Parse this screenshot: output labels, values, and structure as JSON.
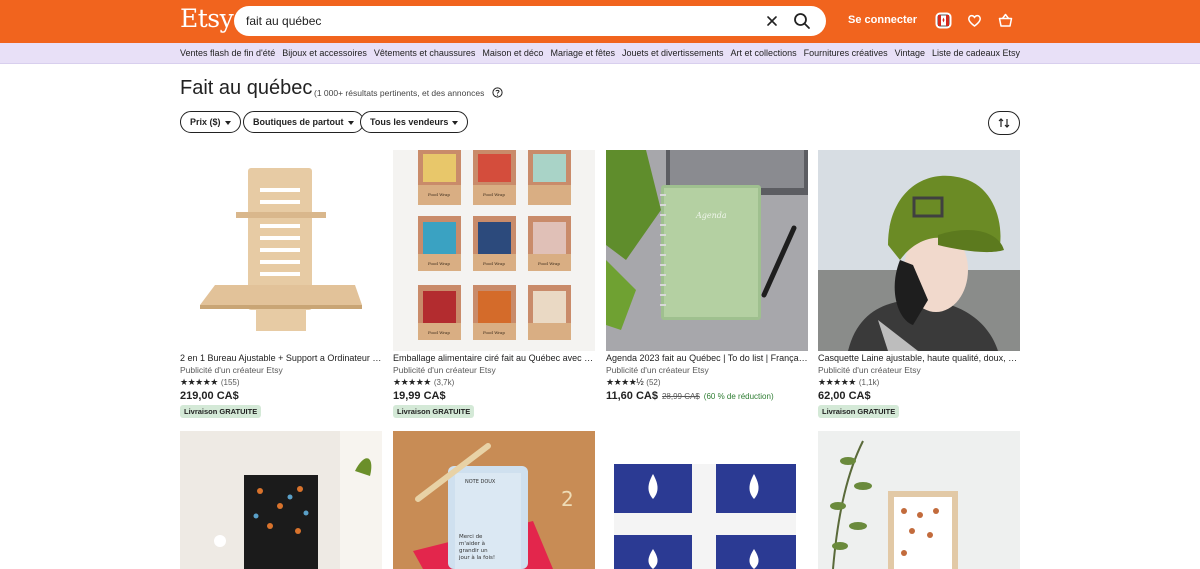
{
  "header": {
    "logo": "Etsy",
    "search_value": "fait au québec",
    "signin_label": "Se connecter"
  },
  "categories": [
    "Ventes flash de fin d'été",
    "Bijoux et accessoires",
    "Vêtements et chaussures",
    "Maison et déco",
    "Mariage et fêtes",
    "Jouets et divertissements",
    "Art et collections",
    "Fournitures créatives",
    "Vintage",
    "Liste de cadeaux Etsy"
  ],
  "page": {
    "title": "Fait au québec",
    "results": "(1 000+ résultats pertinents, et des annonces"
  },
  "filters": {
    "price": "Prix ($)",
    "shops": "Boutiques de partout",
    "sellers": "Tous les vendeurs"
  },
  "listings": [
    {
      "title": "2 en 1 Bureau Ajustable + Support a Ordinateur P...",
      "ad": "Publicité d'un créateur Etsy",
      "stars": "★★★★★",
      "reviews": "(155)",
      "price": "219,00 CA$",
      "badge": "Livraison GRATUITE"
    },
    {
      "title": "Emballage alimentaire ciré fait au Québec avec in...",
      "ad": "Publicité d'un créateur Etsy",
      "stars": "★★★★★",
      "reviews": "(3,7k)",
      "price": "19,99 CA$",
      "badge": "Livraison GRATUITE",
      "wrap_label": "Food Wrap"
    },
    {
      "title": "Agenda 2023 fait au Québec | To do list | Françai s...",
      "ad": "Publicité d'un créateur Etsy",
      "stars": "★★★★½",
      "reviews": "(52)",
      "price": "11,60 CA$",
      "original_price": "28,99 CA$",
      "discount": "(60 % de réduction)",
      "notebook_text": "Agenda"
    },
    {
      "title": "Casquette Laine ajustable, haute qualité, doux, c...",
      "ad": "Publicité d'un créateur Etsy",
      "stars": "★★★★★",
      "reviews": "(1,1k)",
      "price": "62,00 CA$",
      "badge": "Livraison GRATUITE"
    }
  ],
  "second_row": {
    "card_title": "NOTE DOUX",
    "card_lines": [
      "Merci de",
      "m'aider à",
      "grandir un",
      "jour à la fois!"
    ]
  },
  "colors": {
    "brand": "#f1641e",
    "nav_bg": "#e8e0f7",
    "badge_bg": "#d4e9d7",
    "discount": "#2e7d32"
  }
}
